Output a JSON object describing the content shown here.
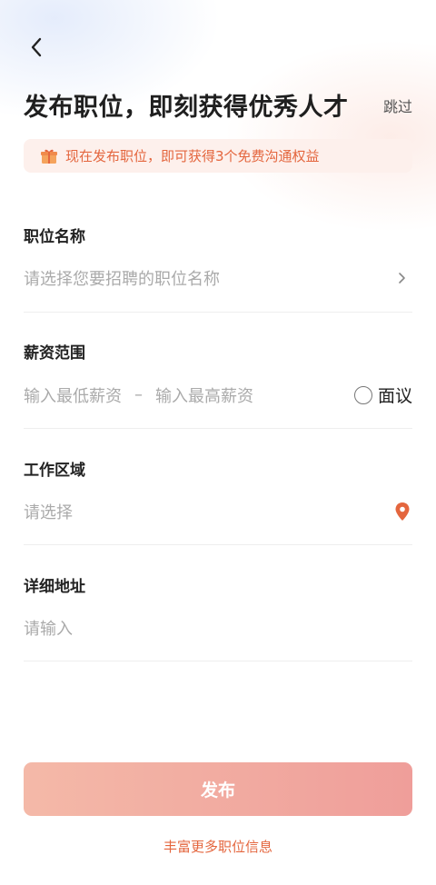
{
  "header": {
    "title": "发布职位，即刻获得优秀人才",
    "skip_label": "跳过",
    "back_icon": "chevron-left-icon"
  },
  "banner": {
    "text": "现在发布职位，即可获得3个免费沟通权益",
    "icon": "gift-icon"
  },
  "form": {
    "position": {
      "label": "职位名称",
      "placeholder": "请选择您要招聘的职位名称"
    },
    "salary": {
      "label": "薪资范围",
      "min_placeholder": "输入最低薪资",
      "separator": "–",
      "max_placeholder": "输入最高薪资",
      "negotiable_label": "面议"
    },
    "area": {
      "label": "工作区域",
      "placeholder": "请选择"
    },
    "address": {
      "label": "详细地址",
      "placeholder": "请输入"
    }
  },
  "actions": {
    "publish_label": "发布",
    "more_info_label": "丰富更多职位信息"
  },
  "colors": {
    "accent": "#e4663e",
    "button_start": "#f4b9a8",
    "button_end": "#ef9e9a",
    "banner_bg": "#fdf0ec"
  }
}
